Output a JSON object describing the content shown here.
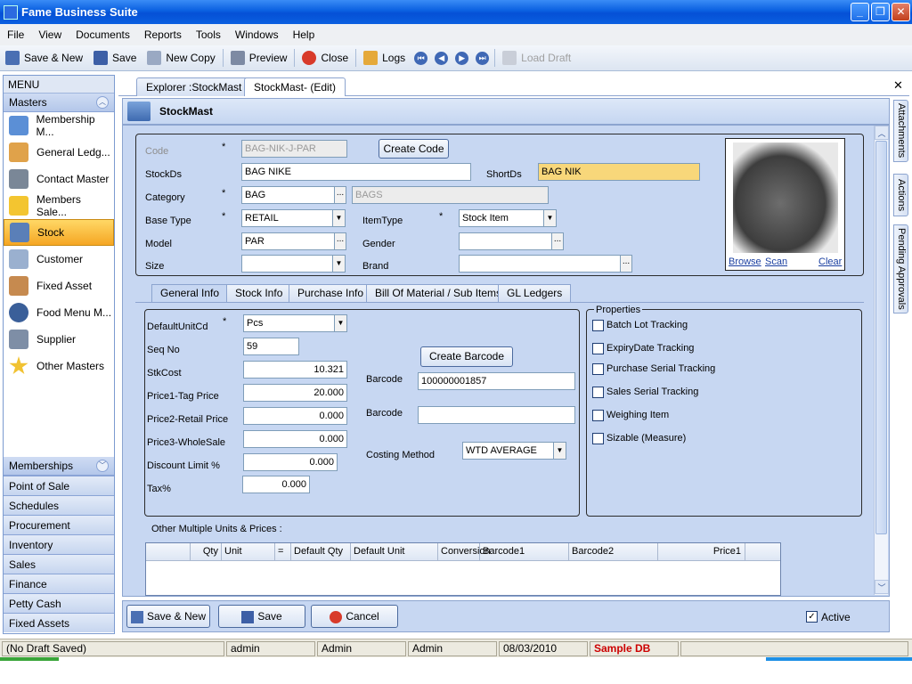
{
  "window": {
    "title": "Fame Business Suite"
  },
  "menubar": [
    "File",
    "View",
    "Documents",
    "Reports",
    "Tools",
    "Windows",
    "Help"
  ],
  "toolbar": {
    "save_new": "Save & New",
    "save": "Save",
    "new_copy": "New Copy",
    "preview": "Preview",
    "close": "Close",
    "logs": "Logs",
    "load_draft": "Load Draft"
  },
  "sidebar": {
    "header": "MENU",
    "group": "Masters",
    "items": [
      {
        "label": "Membership M...",
        "icon": "person-icon"
      },
      {
        "label": "General Ledg...",
        "icon": "ledger-icon"
      },
      {
        "label": "Contact Master",
        "icon": "contact-icon"
      },
      {
        "label": "Members Sale...",
        "icon": "warning-icon"
      },
      {
        "label": "Stock",
        "icon": "stock-icon"
      },
      {
        "label": "Customer",
        "icon": "customer-icon"
      },
      {
        "label": "Fixed Asset",
        "icon": "house-icon"
      },
      {
        "label": "Food Menu M...",
        "icon": "globe-icon"
      },
      {
        "label": "Supplier",
        "icon": "supplier-icon"
      },
      {
        "label": "Other Masters",
        "icon": "star-icon"
      }
    ],
    "bottom": [
      "Memberships",
      "Point of Sale",
      "Schedules",
      "Procurement",
      "Inventory",
      "Sales",
      "Finance",
      "Petty Cash",
      "Fixed Assets"
    ]
  },
  "doctabs": [
    "Explorer :StockMast",
    "StockMast- (Edit)"
  ],
  "form": {
    "title": "StockMast",
    "code_label": "Code",
    "code_value": "BAG-NIK-J-PAR",
    "create_code": "Create Code",
    "stockds_label": "StockDs",
    "stockds_value": "BAG NIKE",
    "shortds_label": "ShortDs",
    "shortds_value": "BAG NIK",
    "category_label": "Category",
    "category_value": "BAG",
    "category_desc": "BAGS",
    "basetype_label": "Base Type",
    "basetype_value": "RETAIL",
    "itemtype_label": "ItemType",
    "itemtype_value": "Stock Item",
    "model_label": "Model",
    "model_value": "PAR",
    "gender_label": "Gender",
    "gender_value": "",
    "size_label": "Size",
    "size_value": "",
    "brand_label": "Brand",
    "brand_value": "",
    "req": "*",
    "ellipsis": "...",
    "photo_links": {
      "browse": "Browse",
      "scan": "Scan",
      "clear": "Clear"
    }
  },
  "tabs": [
    "General Info",
    "Stock Info",
    "Purchase Info",
    "Bill Of Material / Sub Items",
    "GL Ledgers"
  ],
  "general": {
    "unit_label": "DefaultUnitCd",
    "unit_value": "Pcs",
    "seq_label": "Seq No",
    "seq_value": "59",
    "cost_label": "StkCost",
    "cost_value": "10.321",
    "price1_label": "Price1-Tag Price",
    "price1_value": "20.000",
    "price2_label": "Price2-Retail Price",
    "price2_value": "0.000",
    "price3_label": "Price3-WholeSale",
    "price3_value": "0.000",
    "discount_label": "Discount Limit %",
    "discount_value": "0.000",
    "tax_label": "Tax%",
    "tax_value": "0.000",
    "create_barcode": "Create Barcode",
    "barcode_label": "Barcode",
    "barcode1_value": "100000001857",
    "barcode2_value": "",
    "costing_label": "Costing Method",
    "costing_value": "WTD AVERAGE"
  },
  "properties": {
    "title": "Properties",
    "items": [
      "Batch Lot Tracking",
      "ExpiryDate Tracking",
      "Purchase Serial Tracking",
      "Sales Serial Tracking",
      "Weighing Item",
      "Sizable (Measure)"
    ]
  },
  "units": {
    "title": "Other Multiple Units & Prices :",
    "columns": [
      "Qty",
      "Unit",
      "=",
      "Default Qty",
      "Default Unit",
      "Conversion",
      "Barcode1",
      "Barcode2",
      "Price1"
    ]
  },
  "buttons": {
    "save_new": "Save & New",
    "save": "Save",
    "cancel": "Cancel",
    "active": "Active"
  },
  "right_tabs": [
    "Attachments",
    "Actions",
    "Pending Approvals"
  ],
  "status": {
    "draft": "(No Draft Saved)",
    "user1": "admin",
    "user2": "Admin",
    "user3": "Admin",
    "date": "08/03/2010",
    "db": "Sample DB"
  },
  "colors": {
    "title_bar": "#0a5fe0",
    "selected": "#f5a623",
    "db_red": "#cc0000"
  }
}
